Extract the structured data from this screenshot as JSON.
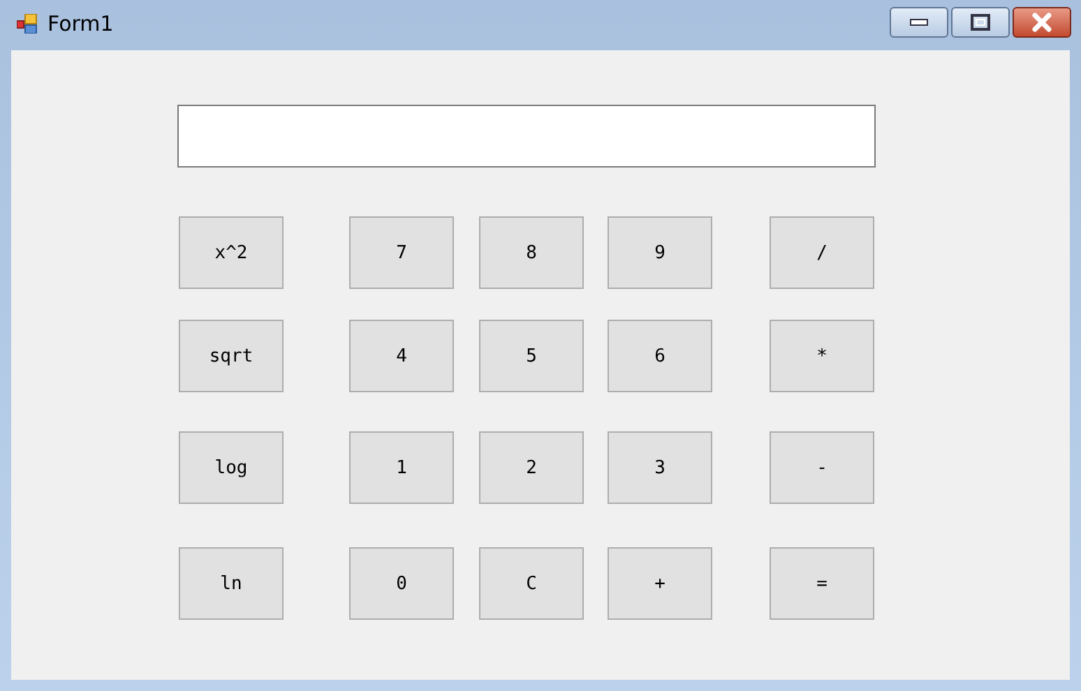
{
  "window": {
    "title": "Form1"
  },
  "keys": [
    [
      "x^2",
      "7",
      "8",
      "9",
      "/"
    ],
    [
      "sqrt",
      "4",
      "5",
      "6",
      "*"
    ],
    [
      "log",
      "1",
      "2",
      "3",
      "-"
    ],
    [
      "ln",
      "0",
      "C",
      "+",
      "="
    ]
  ]
}
